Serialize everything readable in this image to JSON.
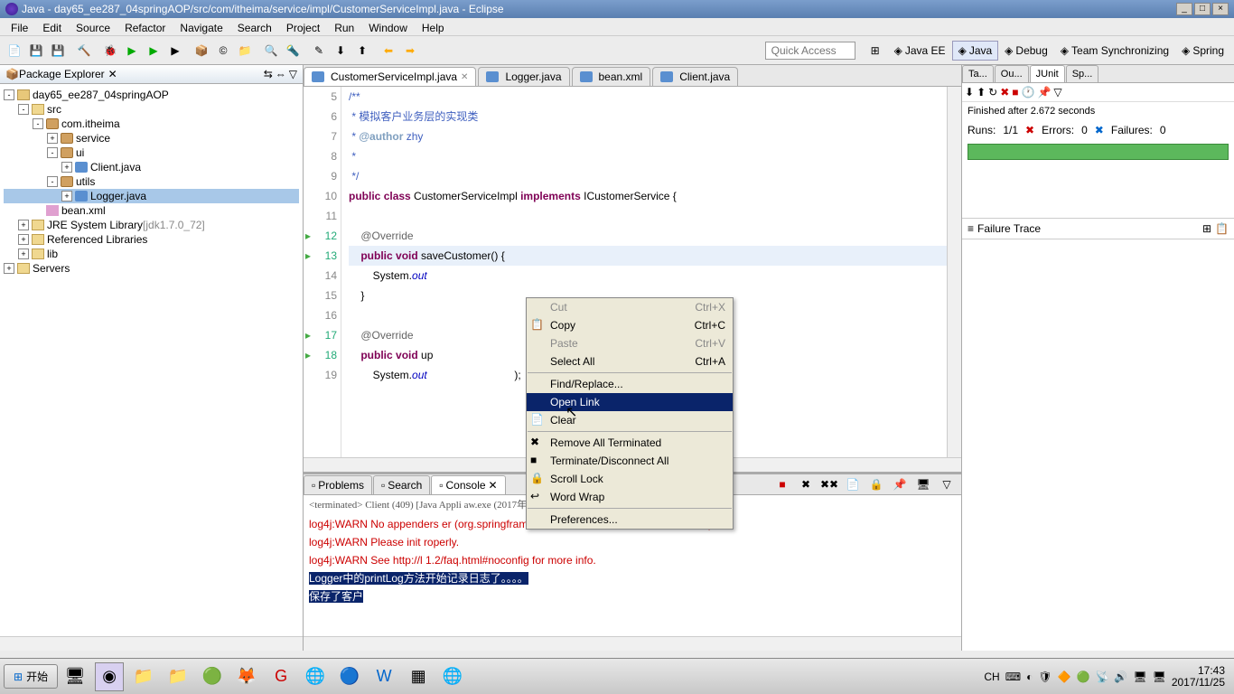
{
  "titlebar": {
    "text": "Java - day65_ee287_04springAOP/src/com/itheima/service/impl/CustomerServiceImpl.java - Eclipse"
  },
  "menu": [
    "File",
    "Edit",
    "Source",
    "Refactor",
    "Navigate",
    "Search",
    "Project",
    "Run",
    "Window",
    "Help"
  ],
  "quick_access": "Quick Access",
  "perspectives": [
    {
      "label": "Java EE"
    },
    {
      "label": "Java",
      "active": true
    },
    {
      "label": "Debug"
    },
    {
      "label": "Team Synchronizing"
    },
    {
      "label": "Spring"
    }
  ],
  "package_explorer": {
    "title": "Package Explorer",
    "items": [
      {
        "indent": 0,
        "toggle": "-",
        "icon": "proj",
        "label": "day65_ee287_04springAOP"
      },
      {
        "indent": 1,
        "toggle": "-",
        "icon": "folder",
        "label": "src"
      },
      {
        "indent": 2,
        "toggle": "-",
        "icon": "pkg",
        "label": "com.itheima"
      },
      {
        "indent": 3,
        "toggle": "+",
        "icon": "pkg",
        "label": "service"
      },
      {
        "indent": 3,
        "toggle": "-",
        "icon": "pkg",
        "label": "ui"
      },
      {
        "indent": 4,
        "toggle": "+",
        "icon": "java",
        "label": "Client.java"
      },
      {
        "indent": 3,
        "toggle": "-",
        "icon": "pkg",
        "label": "utils"
      },
      {
        "indent": 4,
        "toggle": "+",
        "icon": "java",
        "label": "Logger.java",
        "selected": true
      },
      {
        "indent": 2,
        "toggle": "",
        "icon": "xml",
        "label": "bean.xml"
      },
      {
        "indent": 1,
        "toggle": "+",
        "icon": "folder",
        "label": "JRE System Library",
        "suffix": "[jdk1.7.0_72]"
      },
      {
        "indent": 1,
        "toggle": "+",
        "icon": "folder",
        "label": "Referenced Libraries"
      },
      {
        "indent": 1,
        "toggle": "+",
        "icon": "folder",
        "label": "lib"
      },
      {
        "indent": 0,
        "toggle": "+",
        "icon": "folder",
        "label": "Servers"
      }
    ]
  },
  "editor_tabs": [
    {
      "label": "CustomerServiceImpl.java",
      "active": true
    },
    {
      "label": "Logger.java"
    },
    {
      "label": "bean.xml"
    },
    {
      "label": "Client.java"
    }
  ],
  "code_lines": [
    {
      "n": 5,
      "html": "<span class='cm'>/**</span>"
    },
    {
      "n": 6,
      "html": "<span class='cm'> * 模拟客户业务层的实现类</span>"
    },
    {
      "n": 7,
      "html": "<span class='cm'> * <span class='cmtag'>@author</span> zhy</span>"
    },
    {
      "n": 8,
      "html": "<span class='cm'> *</span>"
    },
    {
      "n": 9,
      "html": "<span class='cm'> */</span>"
    },
    {
      "n": 10,
      "html": "<span class='kw'>public</span> <span class='kw'>class</span> CustomerServiceImpl <span class='kw'>implements</span> ICustomerService {"
    },
    {
      "n": 11,
      "html": ""
    },
    {
      "n": 12,
      "marker": "green",
      "html": "    <span class='ann'>@Override</span>"
    },
    {
      "n": 13,
      "marker": "green",
      "hl": true,
      "html": "    <span class='kw'>public</span> <span class='kw'>void</span> saveCustomer() {"
    },
    {
      "n": 14,
      "html": "        System.<span class='fld'>out</span>"
    },
    {
      "n": 15,
      "html": "    }"
    },
    {
      "n": 16,
      "html": ""
    },
    {
      "n": 17,
      "marker": "green",
      "html": "    <span class='ann'>@Override</span>"
    },
    {
      "n": 18,
      "marker": "green",
      "html": "    <span class='kw'>public</span> <span class='kw'>void</span> up"
    },
    {
      "n": 19,
      "html": "        System.<span class='fld'>out</span>                             );"
    }
  ],
  "right_tabs": [
    {
      "label": "Ta..."
    },
    {
      "label": "Ou..."
    },
    {
      "label": "JUnit",
      "active": true
    },
    {
      "label": "Sp..."
    }
  ],
  "junit": {
    "status": "Finished after 2.672 seconds",
    "runs_label": "Runs:",
    "runs": "1/1",
    "errors_label": "Errors:",
    "errors": "0",
    "failures_label": "Failures:",
    "failures": "0",
    "failure_trace": "Failure Trace"
  },
  "bottom_tabs": [
    {
      "label": "Problems"
    },
    {
      "label": "Search"
    },
    {
      "label": "Console",
      "active": true
    }
  ],
  "console": {
    "desc": "<terminated> Client (409) [Java Appli                                aw.exe (2017年11月25日 下午5:27:38)",
    "lines": [
      {
        "cls": "warn",
        "text": "log4j:WARN No appenders                      er (org.springframework.core.env.StandardEnvironment)."
      },
      {
        "cls": "warn",
        "text": "log4j:WARN Please init                                          roperly."
      },
      {
        "cls": "warn",
        "text": "log4j:WARN See http://l                       1.2/faq.html#noconfig for more info."
      },
      {
        "cls": "sel",
        "text": "Logger中的printLog方法开始记录日志了。。。。"
      },
      {
        "cls": "sel",
        "text": "保存了客户"
      }
    ]
  },
  "context_menu": [
    {
      "label": "Cut",
      "shortcut": "Ctrl+X",
      "disabled": true
    },
    {
      "label": "Copy",
      "shortcut": "Ctrl+C",
      "icon": "📋"
    },
    {
      "label": "Paste",
      "shortcut": "Ctrl+V",
      "disabled": true
    },
    {
      "label": "Select All",
      "shortcut": "Ctrl+A"
    },
    {
      "sep": true
    },
    {
      "label": "Find/Replace..."
    },
    {
      "label": "Open Link",
      "highlighted": true
    },
    {
      "label": "Clear",
      "icon": "📄"
    },
    {
      "sep": true
    },
    {
      "label": "Remove All Terminated",
      "icon": "✖"
    },
    {
      "label": "Terminate/Disconnect All",
      "icon": "■"
    },
    {
      "label": "Scroll Lock",
      "icon": "🔒"
    },
    {
      "label": "Word Wrap",
      "icon": "↩"
    },
    {
      "sep": true
    },
    {
      "label": "Preferences..."
    }
  ],
  "taskbar": {
    "start": "开始",
    "lang": "CH",
    "time": "17:43",
    "date": "2017/11/25"
  }
}
